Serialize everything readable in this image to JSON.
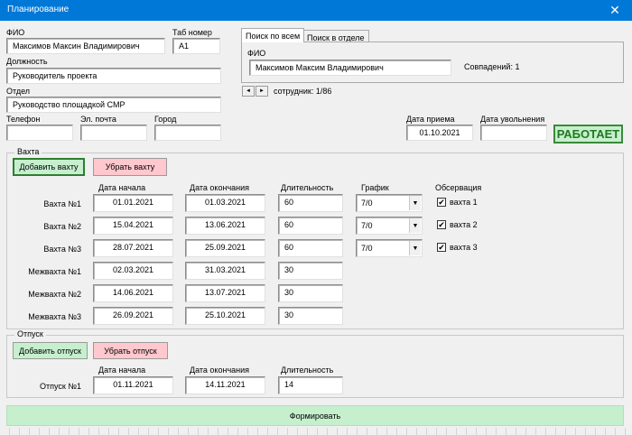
{
  "window": {
    "title": "Планирование",
    "close_label": "✕"
  },
  "employee": {
    "fio_label": "ФИО",
    "fio_value": "Максимов Максин Владимирович",
    "tab_label": "Таб номер",
    "tab_value": "А1",
    "position_label": "Должность",
    "position_value": "Руководитель проекта",
    "dept_label": "Отдел",
    "dept_value": "Руководство площадкой СМР",
    "phone_label": "Телефон",
    "phone_value": "",
    "email_label": "Эл. почта",
    "email_value": "",
    "city_label": "Город",
    "city_value": "",
    "hire_label": "Дата приема",
    "hire_value": "01.10.2021",
    "fire_label": "Дата увольнения",
    "fire_value": "",
    "status": "РАБОТАЕТ"
  },
  "search": {
    "tabs": [
      "Поиск по всем",
      "Поиск в отделе"
    ],
    "fio_label": "ФИО",
    "fio_value": "Максимов Максим Владимирович",
    "matches": "Совпадений: 1",
    "nav_prev": "◄",
    "nav_next": "►",
    "employee_counter": "сотрудник: 1/86"
  },
  "vakhta": {
    "group_title": "Вахта",
    "add_button": "Добавить вахту",
    "remove_button": "Убрать вахту",
    "col_start": "Дата начала",
    "col_end": "Дата окончания",
    "col_duration": "Длительность",
    "col_schedule": "График",
    "col_observation": "Обсервация",
    "rows": [
      {
        "label": "Вахта №1",
        "start": "01.01.2021",
        "end": "01.03.2021",
        "duration": "60",
        "schedule": "7/0",
        "obs": "вахта 1",
        "checked": "✔"
      },
      {
        "label": "Вахта №2",
        "start": "15.04.2021",
        "end": "13.06.2021",
        "duration": "60",
        "schedule": "7/0",
        "obs": "вахта 2",
        "checked": "✔"
      },
      {
        "label": "Вахта №3",
        "start": "28.07.2021",
        "end": "25.09.2021",
        "duration": "60",
        "schedule": "7/0",
        "obs": "вахта 3",
        "checked": "✔"
      }
    ],
    "inter_rows": [
      {
        "label": "Межвахта №1",
        "start": "02.03.2021",
        "end": "31.03.2021",
        "duration": "30"
      },
      {
        "label": "Межвахта №2",
        "start": "14.06.2021",
        "end": "13.07.2021",
        "duration": "30"
      },
      {
        "label": "Межвахта №3",
        "start": "26.09.2021",
        "end": "25.10.2021",
        "duration": "30"
      }
    ]
  },
  "vacation": {
    "group_title": "Отпуск",
    "add_button": "Добавить отпуск",
    "remove_button": "Убрать отпуск",
    "col_start": "Дата начала",
    "col_end": "Дата окончания",
    "col_duration": "Длительность",
    "rows": [
      {
        "label": "Отпуск №1",
        "start": "01.11.2021",
        "end": "14.11.2021",
        "duration": "14"
      }
    ]
  },
  "form_button": "Формировать",
  "colors": {
    "titlebar": "#0078d7",
    "green": "#c6efce",
    "pink": "#ffc7ce",
    "status_text": "#1f7a1f"
  }
}
